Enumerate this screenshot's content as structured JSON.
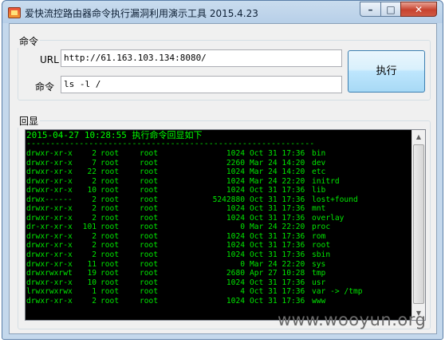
{
  "window": {
    "title": "爱快流控路由器命令执行漏洞利用演示工具 2015.4.23",
    "min_glyph": "–",
    "max_glyph": "□",
    "close_glyph": "✕"
  },
  "command_group": {
    "label": "命令",
    "url_label": "URL",
    "url_value": "http://61.163.103.134:8080/",
    "cmd_label": "命令",
    "cmd_value": "ls -l /",
    "execute_label": "执行"
  },
  "echo_group": {
    "label": "回显",
    "header": "2015-04-27 10:28:55 执行命令回显如下",
    "separator": "------------------------------------------------------------",
    "rows": [
      {
        "perm": "drwxr-xr-x",
        "links": "2",
        "owner": "root",
        "group": "root",
        "size": "1024",
        "date": "Oct 31 17:36",
        "name": "bin"
      },
      {
        "perm": "drwxr-xr-x",
        "links": "7",
        "owner": "root",
        "group": "root",
        "size": "2260",
        "date": "Mar 24 14:20",
        "name": "dev"
      },
      {
        "perm": "drwxr-xr-x",
        "links": "22",
        "owner": "root",
        "group": "root",
        "size": "1024",
        "date": "Mar 24 14:20",
        "name": "etc"
      },
      {
        "perm": "drwxr-xr-x",
        "links": "2",
        "owner": "root",
        "group": "root",
        "size": "1024",
        "date": "Mar 24 22:20",
        "name": "initrd"
      },
      {
        "perm": "drwxr-xr-x",
        "links": "10",
        "owner": "root",
        "group": "root",
        "size": "1024",
        "date": "Oct 31 17:36",
        "name": "lib"
      },
      {
        "perm": "drwx------",
        "links": "2",
        "owner": "root",
        "group": "root",
        "size": "5242880",
        "date": "Oct 31 17:36",
        "name": "lost+found"
      },
      {
        "perm": "drwxr-xr-x",
        "links": "2",
        "owner": "root",
        "group": "root",
        "size": "1024",
        "date": "Oct 31 17:36",
        "name": "mnt"
      },
      {
        "perm": "drwxr-xr-x",
        "links": "2",
        "owner": "root",
        "group": "root",
        "size": "1024",
        "date": "Oct 31 17:36",
        "name": "overlay"
      },
      {
        "perm": "dr-xr-xr-x",
        "links": "101",
        "owner": "root",
        "group": "root",
        "size": "0",
        "date": "Mar 24 22:20",
        "name": "proc"
      },
      {
        "perm": "drwxr-xr-x",
        "links": "2",
        "owner": "root",
        "group": "root",
        "size": "1024",
        "date": "Oct 31 17:36",
        "name": "rom"
      },
      {
        "perm": "drwxr-xr-x",
        "links": "2",
        "owner": "root",
        "group": "root",
        "size": "1024",
        "date": "Oct 31 17:36",
        "name": "root"
      },
      {
        "perm": "drwxr-xr-x",
        "links": "2",
        "owner": "root",
        "group": "root",
        "size": "1024",
        "date": "Oct 31 17:36",
        "name": "sbin"
      },
      {
        "perm": "drwxr-xr-x",
        "links": "11",
        "owner": "root",
        "group": "root",
        "size": "0",
        "date": "Mar 24 22:20",
        "name": "sys"
      },
      {
        "perm": "drwxrwxrwt",
        "links": "19",
        "owner": "root",
        "group": "root",
        "size": "2680",
        "date": "Apr 27 10:28",
        "name": "tmp"
      },
      {
        "perm": "drwxr-xr-x",
        "links": "10",
        "owner": "root",
        "group": "root",
        "size": "1024",
        "date": "Oct 31 17:36",
        "name": "usr"
      },
      {
        "perm": "lrwxrwxrwx",
        "links": "1",
        "owner": "root",
        "group": "root",
        "size": "4",
        "date": "Oct 31 17:36",
        "name": "var -> /tmp"
      },
      {
        "perm": "drwxr-xr-x",
        "links": "2",
        "owner": "root",
        "group": "root",
        "size": "1024",
        "date": "Oct 31 17:36",
        "name": "www"
      }
    ]
  },
  "scrollbar": {
    "up_glyph": "▲",
    "down_glyph": "▼"
  },
  "watermark": "www.wooyun.org",
  "colors": {
    "terminal_bg": "#000000",
    "terminal_text": "#00e600"
  }
}
